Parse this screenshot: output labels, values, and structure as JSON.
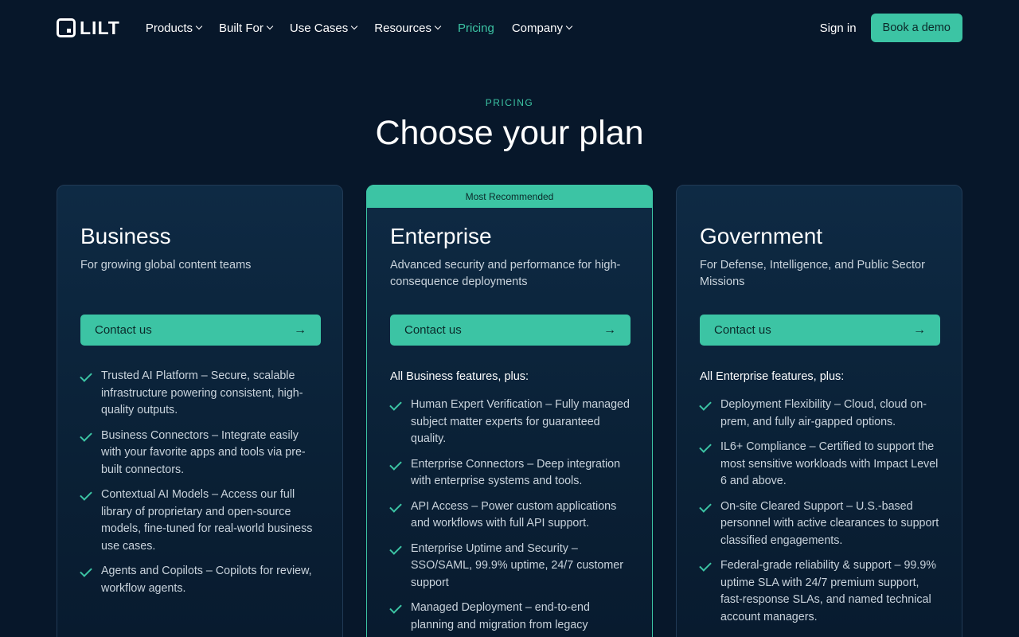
{
  "nav": {
    "logo": "LILT",
    "items": [
      {
        "label": "Products",
        "dropdown": true
      },
      {
        "label": "Built For",
        "dropdown": true
      },
      {
        "label": "Use Cases",
        "dropdown": true
      },
      {
        "label": "Resources",
        "dropdown": true
      },
      {
        "label": "Pricing",
        "dropdown": false,
        "active": true
      },
      {
        "label": "Company",
        "dropdown": true
      }
    ],
    "sign_in": "Sign in",
    "book_demo": "Book a demo"
  },
  "header": {
    "eyebrow": "PRICING",
    "title": "Choose your plan"
  },
  "colors": {
    "background": "#07172a",
    "accent": "#3cc4a4",
    "card": "#0e2a44"
  },
  "plans": [
    {
      "name": "Business",
      "description": "For growing global content teams",
      "cta": "Contact us",
      "features": [
        "Trusted AI Platform – Secure, scalable infrastructure powering consistent, high-quality outputs.",
        "Business Connectors – Integrate easily with your favorite apps and tools via pre-built connectors.",
        "Contextual AI Models – Access our full library of proprietary and open-source models, fine-tuned for real-world business use cases.",
        "Agents and Copilots – Copilots for review, workflow agents."
      ]
    },
    {
      "badge": "Most Recommended",
      "name": "Enterprise",
      "description": "Advanced security and performance for high-consequence deployments",
      "cta": "Contact us",
      "plus_label": "All Business features, plus:",
      "features": [
        "Human Expert Verification – Fully managed subject matter experts for guaranteed quality.",
        "Enterprise Connectors – Deep integration with enterprise systems and tools.",
        "API Access – Power custom applications and workflows with full API support.",
        "Enterprise Uptime and Security – SSO/SAML, 99.9% uptime, 24/7 customer support",
        "Managed Deployment – end-to-end planning and migration from legacy"
      ]
    },
    {
      "name": "Government",
      "description": "For Defense, Intelligence, and Public Sector Missions",
      "cta": "Contact us",
      "plus_label": "All Enterprise features, plus:",
      "features": [
        "Deployment Flexibility – Cloud, cloud on-prem, and fully air-gapped options.",
        "IL6+ Compliance – Certified to support the most sensitive workloads with Impact Level 6 and above.",
        "On-site Cleared Support – U.S.-based personnel with active clearances to support classified engagements.",
        "Federal-grade reliability & support – 99.9% uptime SLA with 24/7 premium support, fast-response SLAs, and named technical account managers."
      ]
    }
  ]
}
